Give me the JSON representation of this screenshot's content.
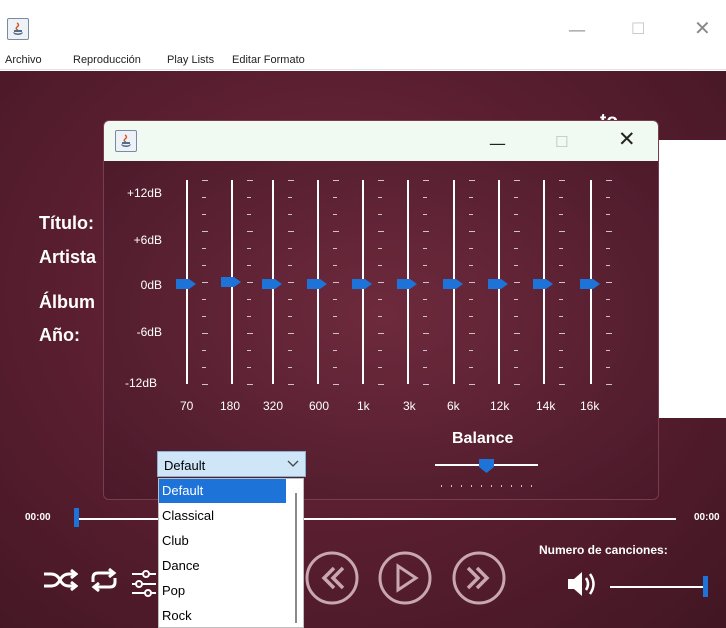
{
  "main_window": {
    "menu": [
      "Archivo",
      "Reproducción",
      "Play Lists",
      "Editar Formato"
    ],
    "playlist_title": "Lista ... Info ... to",
    "meta_labels": {
      "titulo": "Título:",
      "artista": "Artista",
      "album": "Álbum",
      "anio": "Año:"
    },
    "time_start": "00:00",
    "time_end": "00:00",
    "progress_fraction": 0.0,
    "songs_count_label": "Numero de canciones:",
    "volume_fraction": 1.0
  },
  "equalizer_dialog": {
    "db_labels": [
      "+12dB",
      "+6dB",
      "0dB",
      "-6dB",
      "-12dB"
    ],
    "bands": [
      {
        "freq": "70",
        "gain_db": 0
      },
      {
        "freq": "180",
        "gain_db": 0
      },
      {
        "freq": "320",
        "gain_db": 0
      },
      {
        "freq": "600",
        "gain_db": 0
      },
      {
        "freq": "1k",
        "gain_db": 0
      },
      {
        "freq": "3k",
        "gain_db": 0
      },
      {
        "freq": "6k",
        "gain_db": 0
      },
      {
        "freq": "12k",
        "gain_db": 0
      },
      {
        "freq": "14k",
        "gain_db": 0
      },
      {
        "freq": "16k",
        "gain_db": 0
      }
    ],
    "balance_label": "Balance",
    "balance_value": 0.0,
    "preset_selected": "Default",
    "preset_options": [
      "Default",
      "Classical",
      "Club",
      "Dance",
      "Pop",
      "Rock"
    ],
    "accent_color": "#1e73d8"
  }
}
